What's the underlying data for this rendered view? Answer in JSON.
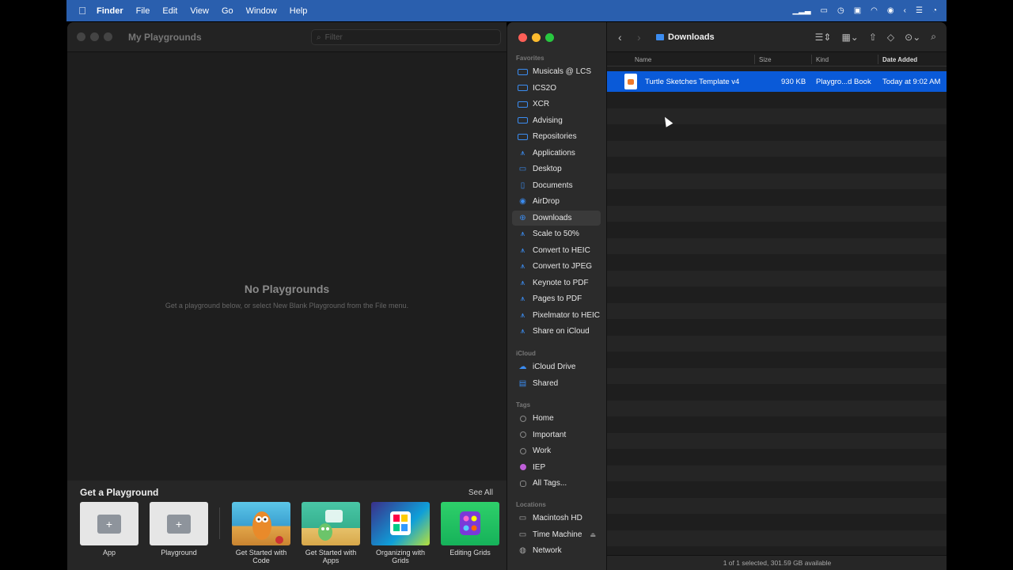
{
  "menubar": {
    "items": [
      "Finder",
      "File",
      "Edit",
      "View",
      "Go",
      "Window",
      "Help"
    ],
    "status_icons": [
      "battery-charging-icon",
      "time-machine-icon",
      "wifi-icon",
      "control-center-icon"
    ]
  },
  "playgrounds": {
    "title": "My Playgrounds",
    "filter_placeholder": "Filter",
    "empty_title": "No Playgrounds",
    "empty_subtitle": "Get a playground below, or select New Blank Playground from the File menu.",
    "get_title": "Get a Playground",
    "see_all": "See All",
    "cards": [
      {
        "label": "App"
      },
      {
        "label": "Playground"
      },
      {
        "label": "Get Started with Code"
      },
      {
        "label": "Get Started with Apps"
      },
      {
        "label": "Organizing with Grids"
      },
      {
        "label": "Editing Grids"
      }
    ]
  },
  "finder": {
    "location": "Downloads",
    "sections": {
      "favorites": "Favorites",
      "icloud": "iCloud",
      "tags": "Tags",
      "locations": "Locations"
    },
    "favorites": [
      "Musicals @ LCS",
      "ICS2O",
      "XCR",
      "Advising",
      "Repositories",
      "Applications",
      "Desktop",
      "Documents",
      "AirDrop",
      "Downloads",
      "Scale to 50%",
      "Convert to HEIC",
      "Convert to JPEG",
      "Keynote to PDF",
      "Pages to PDF",
      "Pixelmator to HEIC",
      "Share on iCloud"
    ],
    "icloud": [
      "iCloud Drive",
      "Shared"
    ],
    "tags": [
      "Home",
      "Important",
      "Work",
      "IEP",
      "All Tags..."
    ],
    "locations": [
      "Macintosh HD",
      "Time Machine",
      "Network"
    ],
    "columns": {
      "name": "Name",
      "size": "Size",
      "kind": "Kind",
      "date": "Date Added"
    },
    "file": {
      "name": "Turtle Sketches Template v4",
      "size": "930 KB",
      "kind": "Playgro...d Book",
      "date": "Today at 9:02 AM"
    },
    "status": "1 of 1 selected, 301.59 GB available",
    "accent": "#0a5ad8"
  }
}
